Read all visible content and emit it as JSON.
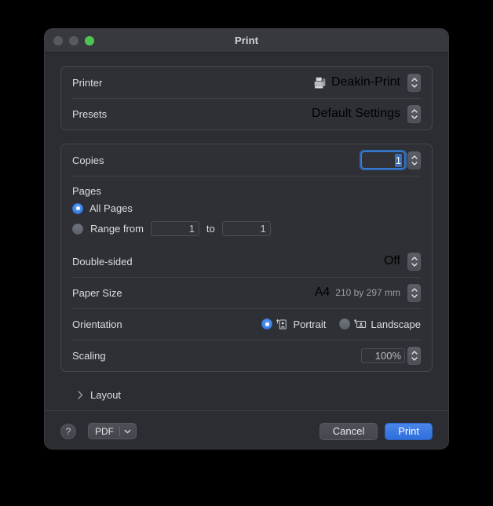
{
  "window": {
    "title": "Print",
    "traffic_lights": [
      "close-button",
      "minimize-button",
      "maximize-button"
    ]
  },
  "printer_panel": {
    "printer": {
      "label": "Printer",
      "value": "Deakin-Print",
      "icon": "printer-icon"
    },
    "presets": {
      "label": "Presets",
      "value": "Default Settings"
    }
  },
  "settings_panel": {
    "copies": {
      "label": "Copies",
      "value": "1"
    },
    "pages": {
      "label": "Pages",
      "all_pages_label": "All Pages",
      "all_pages_selected": true,
      "range_label": "Range from",
      "range_from": "1",
      "to_label": "to",
      "range_to": "1",
      "range_selected": false
    },
    "double_sided": {
      "label": "Double-sided",
      "value": "Off"
    },
    "paper_size": {
      "label": "Paper Size",
      "value": "A4",
      "detail": "210 by 297 mm"
    },
    "orientation": {
      "label": "Orientation",
      "portrait_label": "Portrait",
      "landscape_label": "Landscape",
      "selected": "portrait"
    },
    "scaling": {
      "label": "Scaling",
      "value": "100%"
    }
  },
  "layout_section": {
    "label": "Layout",
    "expanded": false
  },
  "footer": {
    "help_label": "?",
    "pdf_label": "PDF",
    "cancel_label": "Cancel",
    "print_label": "Print"
  },
  "colors": {
    "accent_blue": "#2f6fdc",
    "window_bg": "#2b2d32",
    "panel_bg": "#2e3035",
    "titlebar_bg": "#37393f",
    "maximize_green": "#4cc553",
    "text_primary": "#dcdde0",
    "text_secondary": "#9a9da3"
  }
}
